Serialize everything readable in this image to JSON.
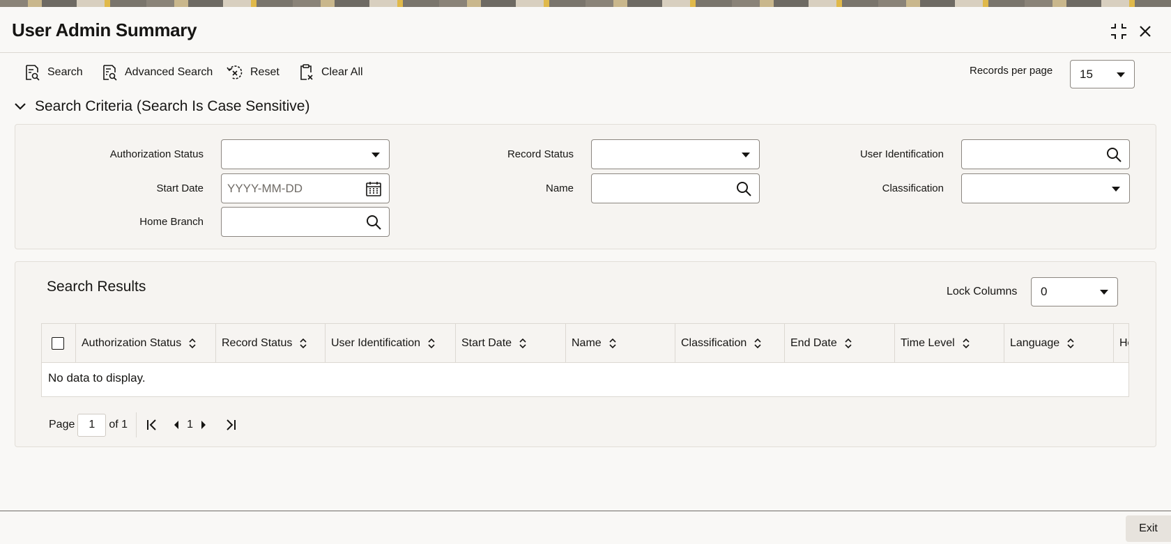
{
  "window": {
    "title": "User Admin Summary"
  },
  "toolbar": {
    "search_label": "Search",
    "advanced_search_label": "Advanced Search",
    "reset_label": "Reset",
    "clear_all_label": "Clear All",
    "records_per_page_label": "Records per page",
    "records_per_page_value": "15"
  },
  "criteria": {
    "section_title": "Search Criteria (Search Is Case Sensitive)",
    "fields": {
      "authorization_status": {
        "label": "Authorization Status",
        "value": ""
      },
      "record_status": {
        "label": "Record Status",
        "value": ""
      },
      "user_identification": {
        "label": "User Identification",
        "value": ""
      },
      "start_date": {
        "label": "Start Date",
        "placeholder": "YYYY-MM-DD"
      },
      "name": {
        "label": "Name",
        "value": ""
      },
      "classification": {
        "label": "Classification",
        "value": ""
      },
      "home_branch": {
        "label": "Home Branch",
        "value": ""
      }
    }
  },
  "results": {
    "title": "Search Results",
    "lock_columns_label": "Lock Columns",
    "lock_columns_value": "0",
    "columns": [
      "Authorization Status",
      "Record Status",
      "User Identification",
      "Start Date",
      "Name",
      "Classification",
      "End Date",
      "Time Level",
      "Language",
      "Ho"
    ],
    "empty_message": "No data to display."
  },
  "pagination": {
    "page_label": "Page",
    "page_value": "1",
    "of_label": "of 1",
    "current_page": "1"
  },
  "footer": {
    "exit_label": "Exit"
  },
  "icons": {
    "maximize": "maximize-icon",
    "close": "close-icon",
    "search": "search-icon",
    "calendar": "calendar-icon"
  }
}
